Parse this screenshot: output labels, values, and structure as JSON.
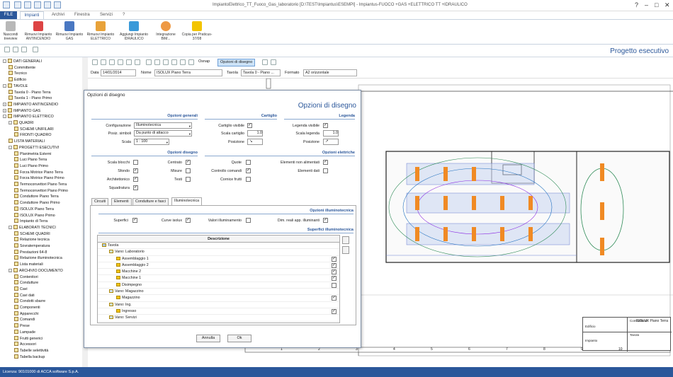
{
  "window": {
    "title": "ImpiantoElettrico_TT_Fuoco_Gas_laboratorio [D:\\TEST\\Impiantus\\ESEMPI] - Impiantus-FUOCO +GAS +ELETTRICO TT +IDRAULICO"
  },
  "menu": {
    "file": "FILE",
    "tabs": [
      "Impianti",
      "Archivi",
      "Finestra",
      "Servizi",
      "?"
    ]
  },
  "ribbon": {
    "items": [
      "Nascondi treeview",
      "Rimuovi Impianto ANTINCENDIO",
      "Rimuovi Impianto GAS",
      "Rimuovi Impianto ELETTRICO",
      "Aggiungi Impianto IDRAULICO",
      "Integrazione BIM...",
      "Copia per Praticus-37/08"
    ]
  },
  "header": {
    "title": "Progetto esecutivo"
  },
  "toolbar": {
    "osnap": "Osnap",
    "opzioni": "Opzioni di disegno"
  },
  "datarow": {
    "data_label": "Data",
    "data_value": "14/01/2014",
    "nome_label": "Nome",
    "nome_value": "ISOLUX Piano Terra",
    "tavola_label": "Tavola",
    "tavola_value": "Tavola 0 - Piano ...",
    "formato_label": "Formato",
    "formato_value": "A2 orizzontale"
  },
  "tree": [
    {
      "t": "DATI GENERALI",
      "l": 0,
      "e": "-"
    },
    {
      "t": "Committente",
      "l": 1
    },
    {
      "t": "Tecnico",
      "l": 1
    },
    {
      "t": "Edificio",
      "l": 1
    },
    {
      "t": "TAVOLE",
      "l": 0,
      "e": "-"
    },
    {
      "t": "Tavola 0 - Piano Terra",
      "l": 1
    },
    {
      "t": "Tavola 1 - Piano Primo",
      "l": 1
    },
    {
      "t": "IMPIANTO ANTINCENDIO",
      "l": 0,
      "e": "+"
    },
    {
      "t": "IMPIANTO GAS",
      "l": 0,
      "e": "+"
    },
    {
      "t": "IMPIANTO ELETTRICO",
      "l": 0,
      "e": "-"
    },
    {
      "t": "QUADRI",
      "l": 1,
      "e": "-"
    },
    {
      "t": "SCHEMI UNIFILARI",
      "l": 2
    },
    {
      "t": "FRONTI QUADRO",
      "l": 2
    },
    {
      "t": "LISTA MATERIALI",
      "l": 1
    },
    {
      "t": "PROGETTI ESECUTIVI",
      "l": 1,
      "e": "-"
    },
    {
      "t": "Planimetria Esterni",
      "l": 2
    },
    {
      "t": "Luci Piano Terra",
      "l": 2
    },
    {
      "t": "Luci Piano Primo",
      "l": 2
    },
    {
      "t": "Forza Motrice Piano Terra",
      "l": 2
    },
    {
      "t": "Forza Motrice Piano Primo",
      "l": 2
    },
    {
      "t": "Termoconvettori Piano Terra",
      "l": 2
    },
    {
      "t": "Termoconvettori Piano Primo",
      "l": 2
    },
    {
      "t": "Conduttore Piano Terra",
      "l": 2
    },
    {
      "t": "Conduttore Piano Primo",
      "l": 2
    },
    {
      "t": "ISOLUX Piano Terra",
      "l": 2
    },
    {
      "t": "ISOLUX Piano Primo",
      "l": 2
    },
    {
      "t": "Impianto di Terra",
      "l": 2
    },
    {
      "t": "ELABORATI TECNICI",
      "l": 1,
      "e": "-"
    },
    {
      "t": "SCHEMI QUADRI",
      "l": 2
    },
    {
      "t": "Relazione tecnica",
      "l": 2
    },
    {
      "t": "Sovratemperatura",
      "l": 2
    },
    {
      "t": "Prestazioni 64-8",
      "l": 2
    },
    {
      "t": "Relazione illuminotecnica",
      "l": 2
    },
    {
      "t": "Lista materiali",
      "l": 2
    },
    {
      "t": "ARCHIVIO DOCUMENTO",
      "l": 1,
      "e": "-"
    },
    {
      "t": "Contenitori",
      "l": 2
    },
    {
      "t": "Condutture",
      "l": 2
    },
    {
      "t": "Cavi",
      "l": 2
    },
    {
      "t": "Cavi dati",
      "l": 2
    },
    {
      "t": "Condotti sbarre",
      "l": 2
    },
    {
      "t": "Componenti",
      "l": 2
    },
    {
      "t": "Apparecchi",
      "l": 2
    },
    {
      "t": "Comandi",
      "l": 2
    },
    {
      "t": "Prese",
      "l": 2
    },
    {
      "t": "Lampade",
      "l": 2
    },
    {
      "t": "Frutti generici",
      "l": 2
    },
    {
      "t": "Accessori",
      "l": 2
    },
    {
      "t": "Tabelle selettività",
      "l": 2
    },
    {
      "t": "Tabella backup",
      "l": 2
    }
  ],
  "dialog": {
    "title": "Opzioni di disegno",
    "header": "Opzioni di disegno",
    "sec_gen": "Opzioni generali",
    "sec_cart": "Cartiglio",
    "sec_leg": "Legenda",
    "sec_dis": "Opzioni disegno",
    "sec_ele": "Opzioni elettriche",
    "config_label": "Configurazione",
    "config_value": "Illuminotecnica",
    "posz_label": "Posiz. simboli",
    "posz_value": "Da punto di attacco",
    "scala_label": "Scala",
    "scala_value": "1 : 100",
    "cart_vis": "Cartiglio visibile",
    "cart_scala": "Scala cartiglio",
    "cart_scala_val": "1.0",
    "cart_pos": "Posizione",
    "cart_pos_val": "↘",
    "leg_vis": "Legenda visibile",
    "leg_scala": "Scala legenda",
    "leg_scala_val": "1.0",
    "leg_pos": "Posizione",
    "leg_pos_val": "↗",
    "dis": [
      "Scala blocchi",
      "Sfondo",
      "Architettonico",
      "Squadratura"
    ],
    "dis2": [
      "Centrato",
      "Misure",
      "Testi"
    ],
    "dis3": [
      "Quote",
      "Controllo comandi",
      "Cornice frutti"
    ],
    "ele": [
      "Elementi non alimentati",
      "Elementi dati"
    ],
    "tabs": [
      "Circuiti",
      "Elementi",
      "Condutture e fasci",
      "Illuminotecnica"
    ],
    "sec_illum": "Opzioni illuminotecnica",
    "superfici": "Superfici",
    "curve": "Curve isolux",
    "valori": "Valori illuminamento",
    "dim": "Dim. reali app. illuminanti",
    "sec_sup": "Superfici illuminotecnica",
    "col": "Descrizione",
    "rows": [
      {
        "t": "Tavola",
        "l": 0,
        "c": false
      },
      {
        "t": "Vano: Laboratorio",
        "l": 1,
        "c": false
      },
      {
        "t": "Assemblaggio 1",
        "l": 2,
        "c": true
      },
      {
        "t": "Assemblaggio 2",
        "l": 2,
        "c": true
      },
      {
        "t": "Macchine 2",
        "l": 2,
        "c": true
      },
      {
        "t": "Macchine 1",
        "l": 2,
        "c": true
      },
      {
        "t": "Disimpegno",
        "l": 2,
        "c": false
      },
      {
        "t": "Vano: Magazzino",
        "l": 1,
        "c": false
      },
      {
        "t": "Magazzino",
        "l": 2,
        "c": true
      },
      {
        "t": "Vano: Ing.",
        "l": 1,
        "c": false
      },
      {
        "t": "Ingresso",
        "l": 2,
        "c": true
      },
      {
        "t": "Vano: Servizi",
        "l": 1,
        "c": false
      }
    ],
    "annulla": "Annulla",
    "ok": "Ok"
  },
  "cartiglio": {
    "titolo": "ISOLUX Piano Terra",
    "edificio": "Edificio",
    "committente": "Committente",
    "tavola": "Tavola",
    "impianto": "Impianto",
    "nums": [
      "1",
      "2",
      "3",
      "4",
      "5",
      "6",
      "7",
      "8",
      "9",
      "10"
    ]
  },
  "status": "Licenza: 90101000 di ACCA software S.p.A."
}
